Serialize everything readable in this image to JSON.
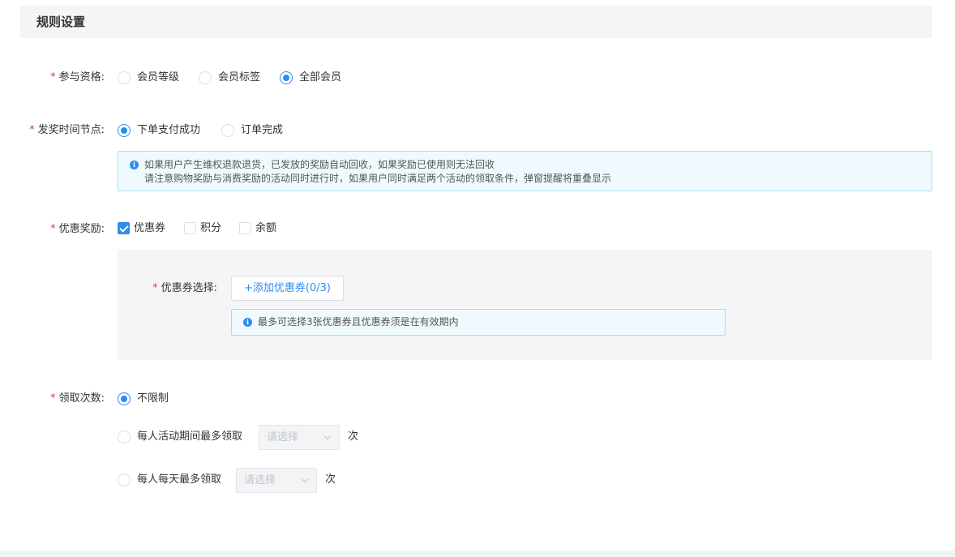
{
  "section": {
    "title": "规则设置"
  },
  "eligibility": {
    "required_mark": "*",
    "label": "参与资格:",
    "options": [
      {
        "label": "会员等级",
        "selected": false
      },
      {
        "label": "会员标签",
        "selected": false
      },
      {
        "label": "全部会员",
        "selected": true
      }
    ]
  },
  "award_time": {
    "required_mark": "*",
    "label": "发奖时间节点:",
    "options": [
      {
        "label": "下单支付成功",
        "selected": true
      },
      {
        "label": "订单完成",
        "selected": false
      }
    ],
    "notice": {
      "icon": "info-icon",
      "lines": [
        "如果用户产生维权退款退货，已发放的奖励自动回收，如果奖励已使用则无法回收",
        "请注意购物奖励与消费奖励的活动同时进行时，如果用户同时满足两个活动的领取条件，弹窗提醒将重叠显示"
      ]
    }
  },
  "rewards": {
    "required_mark": "*",
    "label": "优惠奖励:",
    "options": [
      {
        "label": "优惠券",
        "checked": true
      },
      {
        "label": "积分",
        "checked": false
      },
      {
        "label": "余额",
        "checked": false
      }
    ],
    "coupon": {
      "required_mark": "*",
      "label": "优惠券选择:",
      "add_button": "+添加优惠券(0/3)",
      "notice": "最多可选择3张优惠券且优惠券须是在有效期内"
    }
  },
  "claim_times": {
    "required_mark": "*",
    "label": "领取次数:",
    "options": [
      {
        "label": "不限制",
        "selected": true
      },
      {
        "label": "每人活动期间最多领取",
        "selected": false,
        "placeholder": "请选择",
        "unit": "次"
      },
      {
        "label": "每人每天最多领取",
        "selected": false,
        "placeholder": "请选择",
        "unit": "次"
      }
    ]
  },
  "colors": {
    "accent": "#2d8cf0",
    "required": "#e4393c",
    "panel_bg": "#f5f5f7",
    "notice_border": "#9fdff0"
  }
}
